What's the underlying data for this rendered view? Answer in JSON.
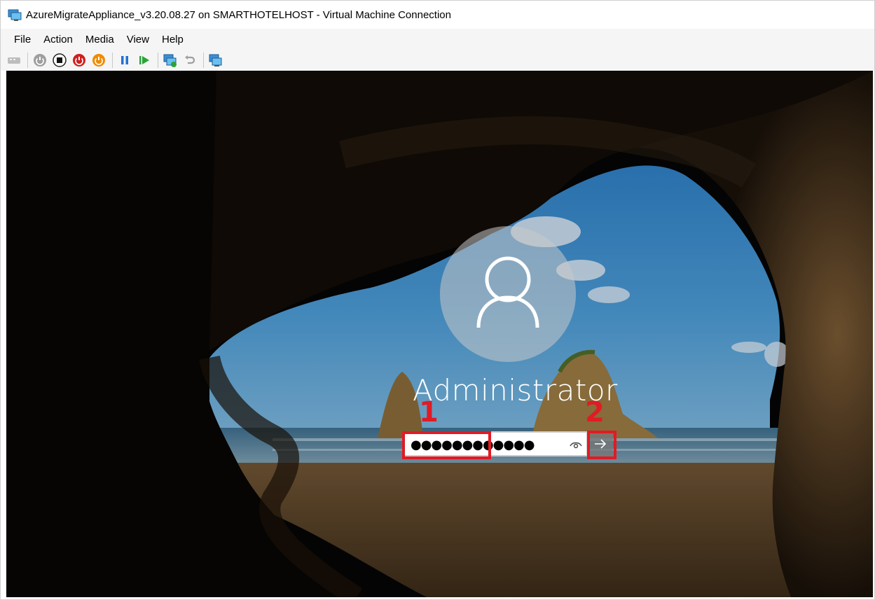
{
  "window": {
    "title": "AzureMigrateAppliance_v3.20.08.27 on SMARTHOTELHOST - Virtual Machine Connection",
    "icon": "vm-connection-icon"
  },
  "menubar": {
    "items": [
      {
        "label": "File"
      },
      {
        "label": "Action"
      },
      {
        "label": "Media"
      },
      {
        "label": "View"
      },
      {
        "label": "Help"
      }
    ]
  },
  "toolbar": {
    "buttons": [
      {
        "icon": "ctrl-alt-del-icon"
      },
      {
        "icon": "start-icon"
      },
      {
        "icon": "turn-off-icon"
      },
      {
        "icon": "shut-down-icon"
      },
      {
        "icon": "save-state-icon"
      },
      {
        "icon": "pause-icon"
      },
      {
        "icon": "resume-icon"
      },
      {
        "icon": "checkpoint-icon"
      },
      {
        "icon": "revert-icon"
      },
      {
        "icon": "enhanced-session-icon"
      }
    ]
  },
  "login": {
    "username": "Administrator",
    "password_value": "●●●●●●●●●●●●",
    "callout_1": "1",
    "callout_2": "2"
  },
  "colors": {
    "callout": "#e01b24",
    "sky": "#2a6fa8",
    "sand": "#8a6a3d"
  }
}
